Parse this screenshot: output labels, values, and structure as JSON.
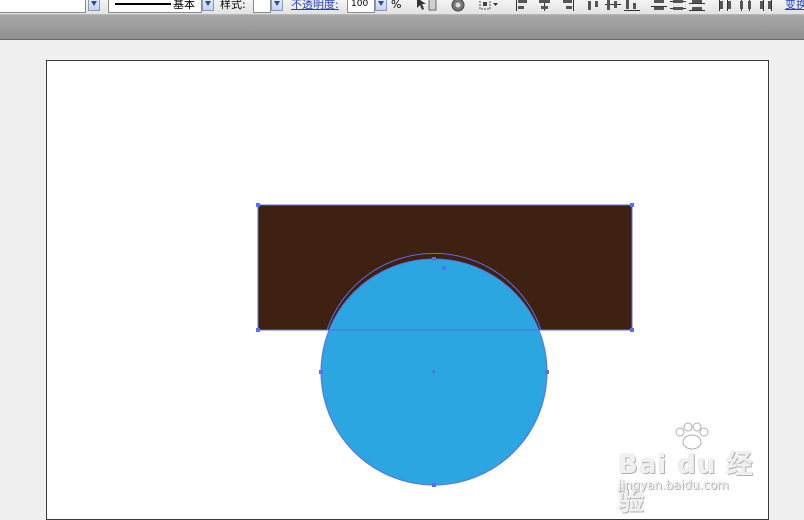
{
  "toolbar": {
    "stroke_profile_label": "基本",
    "style_label": "样式:",
    "opacity_label": "不透明度:",
    "opacity_value": "100",
    "opacity_unit": "%",
    "transform_link": "变换"
  },
  "artwork": {
    "rectangle_fill": "#3f2111",
    "circle_fill": "#2ba6e1",
    "selection_color": "#5b6fe6"
  },
  "watermark": {
    "logo_text": "Bai du 经验",
    "url": "jingyan.baidu.com"
  }
}
